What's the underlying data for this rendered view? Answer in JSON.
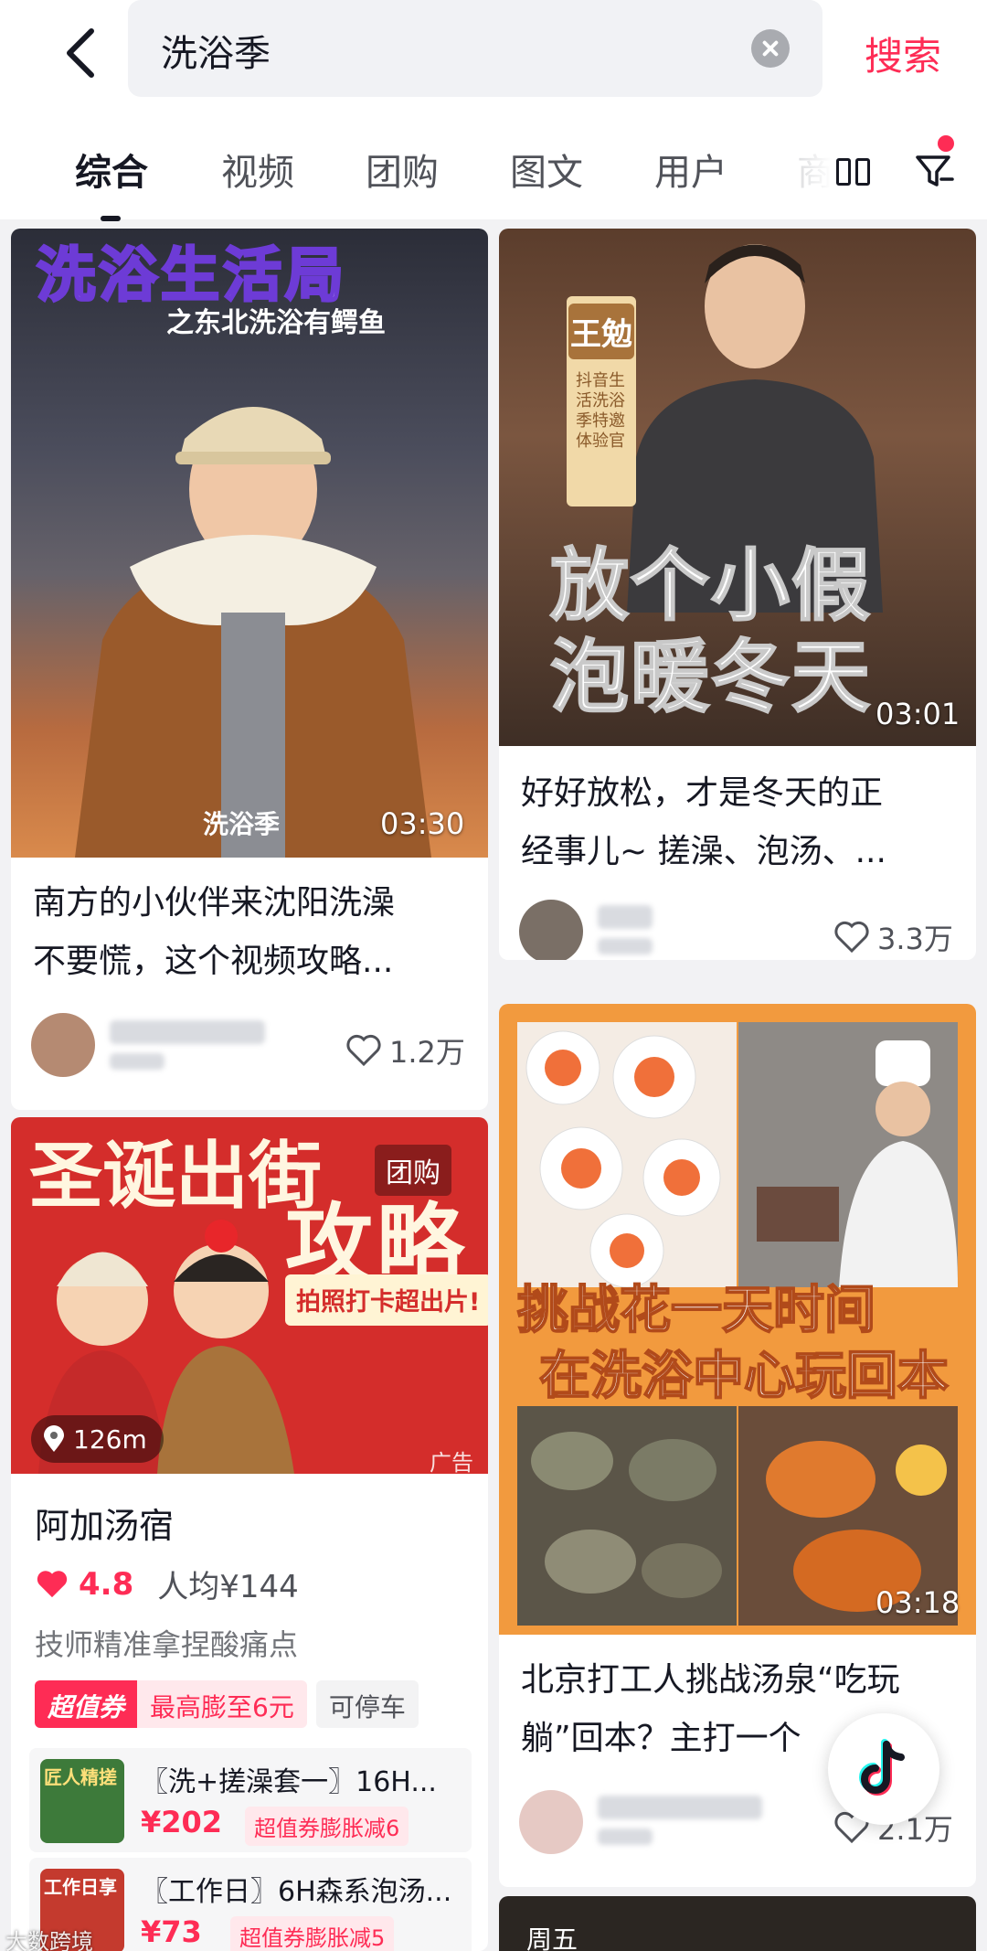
{
  "header": {
    "search_value": "洗浴季",
    "search_button": "搜索"
  },
  "tabs": [
    "综合",
    "视频",
    "团购",
    "图文",
    "用户",
    "商"
  ],
  "cards": [
    {
      "overlay_title": "洗浴生活局",
      "overlay_subtitle": "之东北洗浴有鳄鱼",
      "overlay_tag": "洗浴季",
      "duration": "03:30",
      "title_line1": "南方的小伙伴来沈阳洗澡",
      "title_line2": "不要慌，这个视频攻略...",
      "likes": "1.2万"
    },
    {
      "badge_name": "王勉",
      "badge_caption": "抖音生活洗浴季特邀体验官",
      "overlay_line1": "放个小假",
      "overlay_line2": "泡暖冬天",
      "duration": "03:01",
      "title_line1": "好好放松，才是冬天的正",
      "title_line2": "经事儿~ 搓澡、泡汤、...",
      "likes": "3.3万"
    },
    {
      "overlay_top": "圣诞出街",
      "overlay_big": "攻略",
      "overlay_strip": "拍照打卡超出片!",
      "badge": "团购",
      "distance": "126m",
      "ad_label": "广告",
      "shop_name": "阿加汤宿",
      "rating": "4.8",
      "avg_price": "人均¥144",
      "promo_text": "技师精准拿捏酸痛点",
      "coupon_label": "超值券",
      "coupon_value": "最高膨至6元",
      "parking": "可停车",
      "deals": [
        {
          "thumb_text": "匠人精搓",
          "title": "〖洗+搓澡套一〗16H...",
          "price": "¥202",
          "tag": "超值券膨胀减6"
        },
        {
          "thumb_text": "工作日享",
          "title": "〖工作日〗6H森系泡汤...",
          "price": "¥73",
          "tag": "超值券膨胀减5"
        }
      ]
    },
    {
      "overlay_line1": "挑战花一天时间",
      "overlay_line2": "在洗浴中心玩回本",
      "duration": "03:18",
      "title_line1": "北京打工人挑战汤泉“吃玩",
      "title_line2": "躺”回本？主打一个",
      "likes": "2.1万"
    },
    {
      "overlay_text": "周五"
    }
  ],
  "watermark": "大数跨境",
  "colors": {
    "accent": "#fe2c55",
    "text": "#161823",
    "background": "#f2f2f4"
  }
}
